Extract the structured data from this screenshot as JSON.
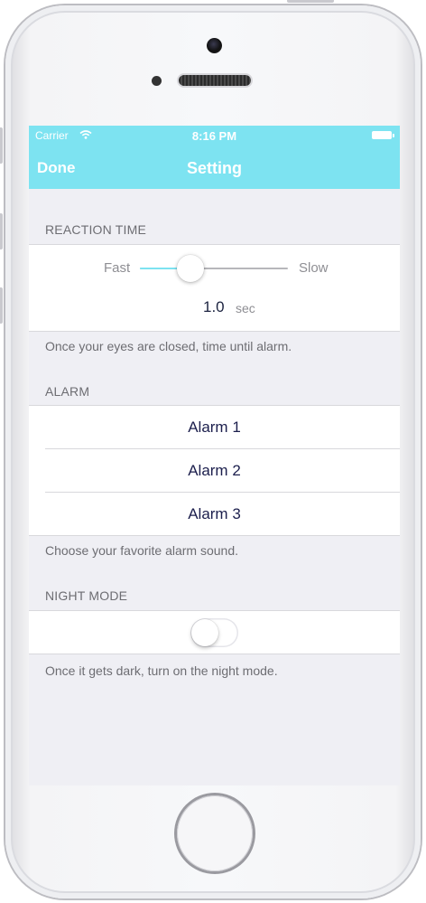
{
  "status_bar": {
    "carrier": "Carrier",
    "time": "8:16 PM"
  },
  "nav": {
    "done_label": "Done",
    "title": "Setting"
  },
  "reaction_time": {
    "header": "REACTION TIME",
    "min_label": "Fast",
    "max_label": "Slow",
    "value": "1.0",
    "unit": "sec",
    "slider_fraction": 0.34,
    "footer": "Once your eyes are closed, time until alarm."
  },
  "alarm": {
    "header": "ALARM",
    "options": [
      "Alarm 1",
      "Alarm 2",
      "Alarm 3"
    ],
    "footer": "Choose your favorite alarm sound."
  },
  "night_mode": {
    "header": "NIGHT MODE",
    "enabled": false,
    "footer": "Once it gets dark, turn on the night mode."
  },
  "colors": {
    "nav_bar": "#7de3f1",
    "slider_fill": "#7de3f1",
    "slider_track": "#b7b7bb",
    "background": "#efeff4"
  },
  "icons": [
    "wifi-icon",
    "battery-icon"
  ]
}
